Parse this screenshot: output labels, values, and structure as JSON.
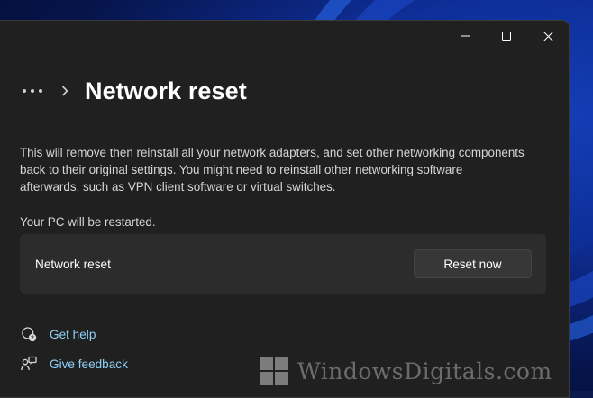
{
  "header": {
    "breadcrumb_more": "...",
    "title": "Network reset"
  },
  "content": {
    "description": "This will remove then reinstall all your network adapters, and set other networking components back to their original settings. You might need to reinstall other networking software afterwards, such as VPN client software or virtual switches.",
    "restart_note": "Your PC will be restarted."
  },
  "card": {
    "label": "Network reset",
    "button_label": "Reset now"
  },
  "links": [
    {
      "label": "Get help",
      "icon": "help-chat-icon"
    },
    {
      "label": "Give feedback",
      "icon": "feedback-icon"
    }
  ],
  "watermark": {
    "text": "WindowsDigitals.com"
  },
  "colors": {
    "window_bg": "#202020",
    "card_bg": "#2c2c2c",
    "button_bg": "#373737",
    "link": "#8fd0f6",
    "text": "#ffffff",
    "muted_text": "#d6d6d6"
  }
}
